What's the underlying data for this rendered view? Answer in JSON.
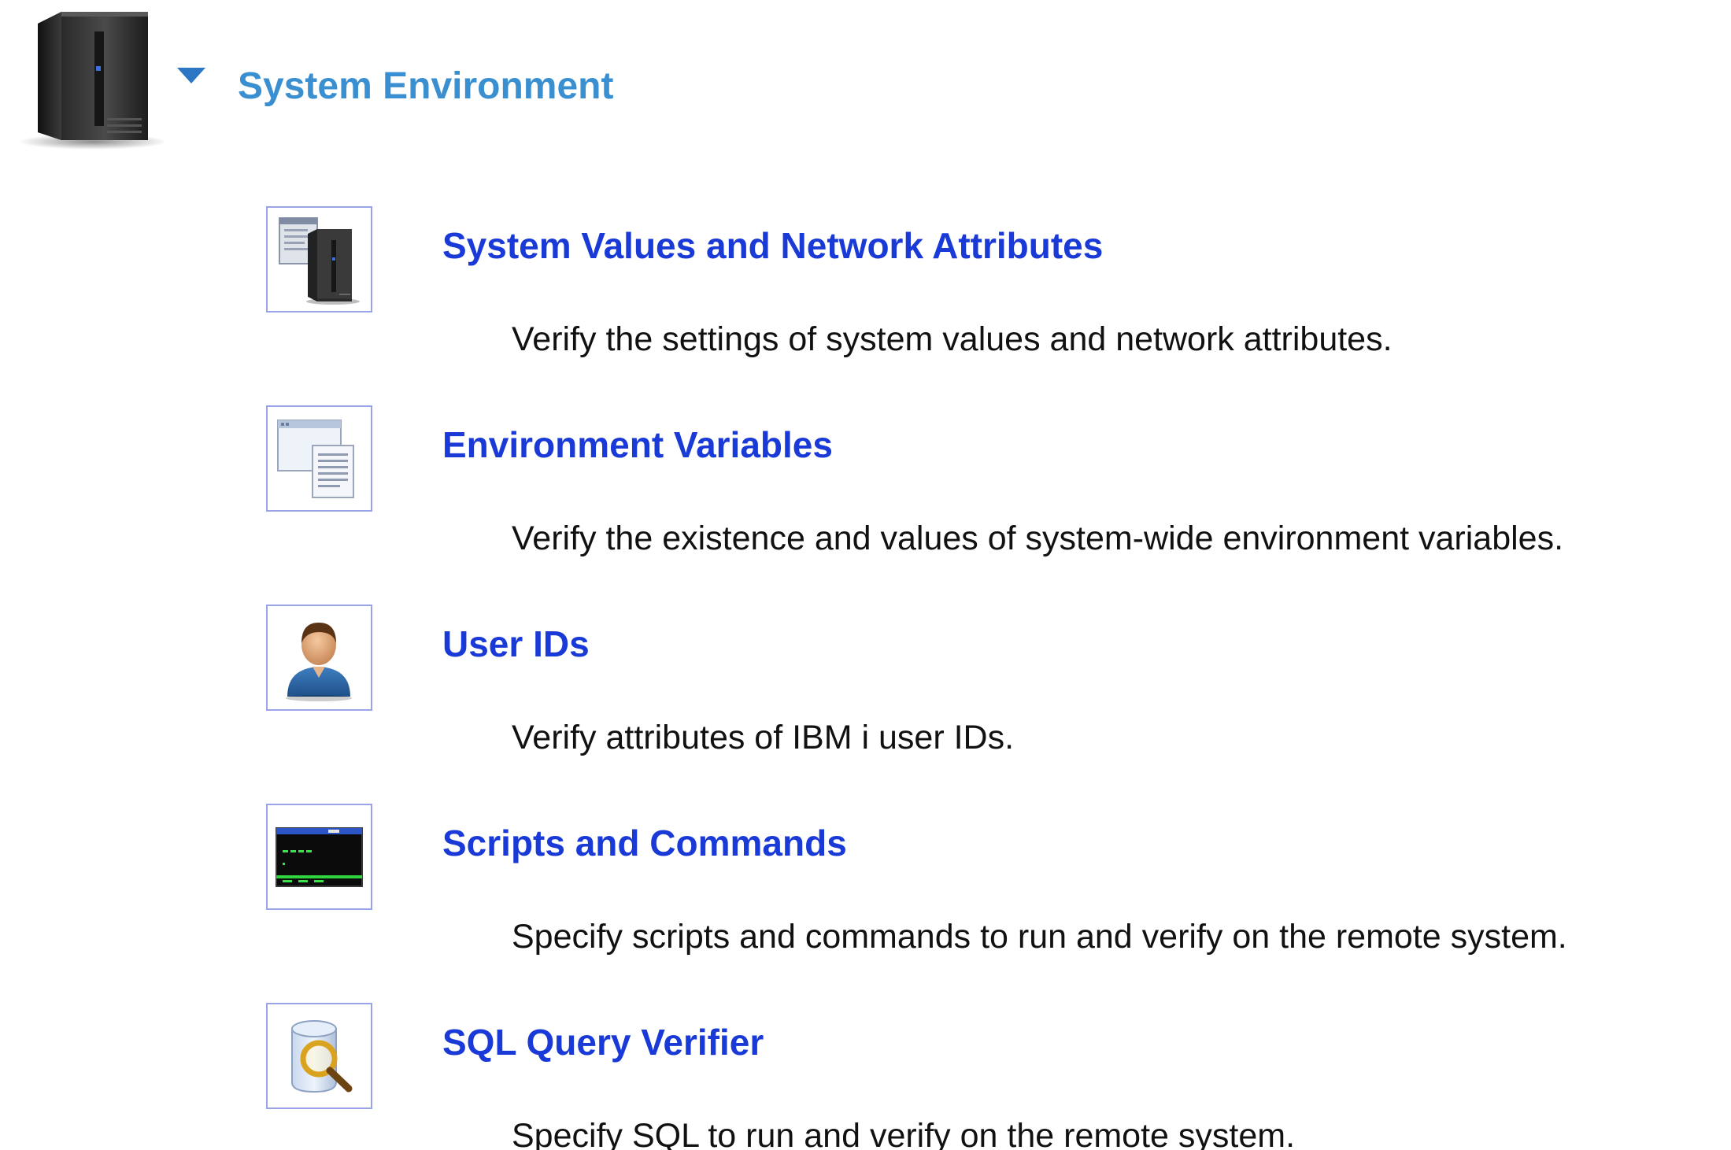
{
  "section": {
    "title": "System Environment",
    "expanded": true,
    "icon": "server-tower-icon"
  },
  "items": [
    {
      "title": "System Values and Network Attributes",
      "description": "Verify the settings of system values and network attributes.",
      "icon": "system-values-icon"
    },
    {
      "title": "Environment Variables",
      "description": "Verify the existence and values of system-wide environment variables.",
      "icon": "environment-variables-icon"
    },
    {
      "title": "User IDs",
      "description": "Verify attributes of IBM i user IDs.",
      "icon": "user-icon"
    },
    {
      "title": "Scripts and Commands",
      "description": "Specify scripts and commands to run and verify on the remote system.",
      "icon": "terminal-icon"
    },
    {
      "title": "SQL Query Verifier",
      "description": "Specify SQL to run and verify on the remote system.",
      "icon": "database-search-icon"
    }
  ],
  "colors": {
    "section_title": "#3a8fd0",
    "item_title": "#1a3ad8",
    "description": "#111111",
    "icon_border": "#9aa3e8"
  }
}
